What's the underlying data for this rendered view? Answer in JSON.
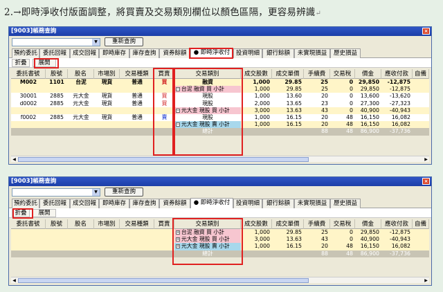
{
  "caption": {
    "text": "2.→即時淨收付版面調整，將買賣及交易類別欄位以顏色區隔，更容易辨識",
    "ret": "↵"
  },
  "window": {
    "title": "[9003]帳務查詢",
    "close": "×",
    "requery_label": "重新查詢",
    "tabs": [
      "預約委託",
      "委託回報",
      "成交回報",
      "即時庫存",
      "庫存查詢",
      "資券餘額",
      "● 即時淨收付",
      "投資明細",
      "銀行餘額",
      "未實現損益",
      "歷史損益"
    ]
  },
  "panel1": {
    "sub_buttons": [
      "折疊",
      "展開"
    ],
    "columns": [
      "委託書號",
      "股號",
      "股名",
      "市場別",
      "交易種類",
      "買賣",
      "交易類別",
      "成交股數",
      "成交單價",
      "手續費",
      "交易稅",
      "價金",
      "應收付款",
      "自備"
    ],
    "rows": [
      {
        "order": "M002",
        "code": "1101",
        "name": "台泥",
        "market": "現貨",
        "kind": "普通",
        "side": "買",
        "type": "融資",
        "shares": "1,000",
        "price": "29.85",
        "fee": "25",
        "tax": "0",
        "amount": "29,850",
        "net": "-12,875",
        "style": "y",
        "bold": true,
        "sideColor": "red"
      },
      {
        "order": "",
        "code": "",
        "name": "",
        "market": "",
        "kind": "",
        "side": "",
        "type": "台泥 融資 買 小計",
        "shares": "1,000",
        "price": "29.85",
        "fee": "25",
        "tax": "0",
        "amount": "29,850",
        "net": "-12,875",
        "style": "y",
        "cat": "pink",
        "pm": "−"
      },
      {
        "order": "30001",
        "code": "2885",
        "name": "元大金",
        "market": "現貨",
        "kind": "普通",
        "side": "買",
        "type": "現股",
        "shares": "1,000",
        "price": "13.60",
        "fee": "20",
        "tax": "0",
        "amount": "13,600",
        "net": "-13,620",
        "style": "w",
        "sideColor": "red"
      },
      {
        "order": "d0002",
        "code": "2885",
        "name": "元大金",
        "market": "現貨",
        "kind": "普通",
        "side": "買",
        "type": "現股",
        "shares": "2,000",
        "price": "13.65",
        "fee": "23",
        "tax": "0",
        "amount": "27,300",
        "net": "-27,323",
        "style": "w",
        "sideColor": "red"
      },
      {
        "order": "",
        "code": "",
        "name": "",
        "market": "",
        "kind": "",
        "side": "",
        "type": "元大金 現股 買 小計",
        "shares": "3,000",
        "price": "13.63",
        "fee": "43",
        "tax": "0",
        "amount": "40,900",
        "net": "-40,943",
        "style": "y",
        "cat": "pink",
        "pm": "−"
      },
      {
        "order": "f0002",
        "code": "2885",
        "name": "元大金",
        "market": "現貨",
        "kind": "普通",
        "side": "賣",
        "type": "現股",
        "shares": "1,000",
        "price": "16.15",
        "fee": "20",
        "tax": "48",
        "amount": "16,150",
        "net": "16,082",
        "style": "w",
        "sideColor": "blue"
      },
      {
        "order": "",
        "code": "",
        "name": "",
        "market": "",
        "kind": "",
        "side": "",
        "type": "元大金 現股 賣 小計",
        "shares": "1,000",
        "price": "16.15",
        "fee": "20",
        "tax": "48",
        "amount": "16,150",
        "net": "16,082",
        "style": "y",
        "cat": "blue",
        "pm": "−"
      },
      {
        "order": "",
        "code": "",
        "name": "",
        "market": "",
        "kind": "",
        "side": "",
        "type": "總計",
        "shares": "",
        "price": "",
        "fee": "88",
        "tax": "48",
        "amount": "86,900",
        "net": "-37,736",
        "style": "total"
      }
    ]
  },
  "panel2": {
    "sub_buttons": [
      "折疊",
      "展開"
    ],
    "columns": [
      "委託書號",
      "股號",
      "股名",
      "市場別",
      "交易種類",
      "買賣",
      "交易類別",
      "成交股數",
      "成交單價",
      "手續費",
      "交易稅",
      "價金",
      "應收付款",
      "自備"
    ],
    "rows": [
      {
        "type": "台泥 融資 買 小計",
        "shares": "1,000",
        "price": "29.85",
        "fee": "25",
        "tax": "0",
        "amount": "29,850",
        "net": "-12,875",
        "style": "y",
        "cat": "pink",
        "pm": "+"
      },
      {
        "type": "元大金 現股 買 小計",
        "shares": "3,000",
        "price": "13.63",
        "fee": "43",
        "tax": "0",
        "amount": "40,900",
        "net": "-40,943",
        "style": "y",
        "cat": "pink",
        "pm": "+"
      },
      {
        "type": "元大金 現股 賣 小計",
        "shares": "1,000",
        "price": "16.15",
        "fee": "20",
        "tax": "48",
        "amount": "16,150",
        "net": "16,082",
        "style": "y",
        "cat": "blue",
        "pm": "+"
      },
      {
        "type": "總計",
        "shares": "",
        "price": "",
        "fee": "88",
        "tax": "48",
        "amount": "86,900",
        "net": "-37,736",
        "style": "total"
      }
    ]
  }
}
